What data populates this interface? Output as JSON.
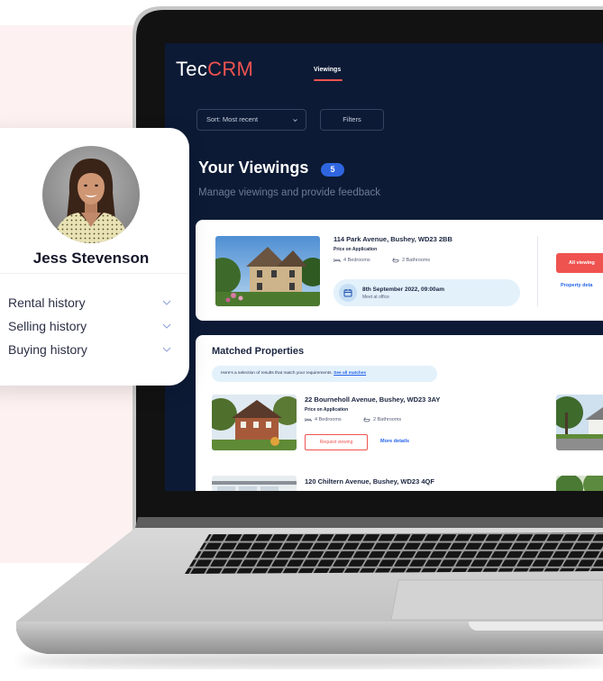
{
  "colors": {
    "accent": "#ef5350",
    "navy": "#0c1a35",
    "badge": "#2f66e0",
    "link": "#2563eb",
    "pill": "#e3f1fb",
    "pink_background": "#fdf1f1"
  },
  "icons": {
    "bed": "bed-icon",
    "bath": "bath-icon",
    "calendar": "calendar-icon",
    "chevron": "chevron-down-icon"
  },
  "profile": {
    "name": "Jess Stevenson",
    "items": [
      {
        "label": "Rental history"
      },
      {
        "label": "Selling history"
      },
      {
        "label": "Buying history"
      }
    ]
  },
  "app": {
    "logo": {
      "part1": "Tec",
      "part2": "CRM"
    },
    "nav": {
      "active": "Viewings"
    },
    "toolbar": {
      "sort_label": "Sort: Most recent",
      "filters_label": "Filters"
    },
    "page": {
      "title": "Your Viewings",
      "count": 5,
      "subtitle": "Manage viewings and provide feedback"
    }
  },
  "viewing": {
    "address": "114 Park Avenue, Bushey, WD23 2BB",
    "price": "Price on Application",
    "bedrooms": "4 Bedrooms",
    "bathrooms": "2 Bathrooms",
    "date": "8th September 2022, 09:00am",
    "location": "Meet at office",
    "all_viewings_button": "All viewing",
    "details_link": "Property deta"
  },
  "matched": {
    "title": "Matched Properties",
    "intro": "Here's a selection of results that match your requirements.",
    "intro_link": "See all matches",
    "properties": [
      {
        "address": "22 Bourneholl Avenue, Bushey, WD23 3AY",
        "price": "Price on Application",
        "bedrooms": "4 Bedrooms",
        "bathrooms": "2 Bathrooms",
        "request_button": "Request viewing",
        "details_link": "More details"
      },
      {
        "address": "120 Chiltern Avenue, Bushey, WD23 4QF"
      }
    ]
  }
}
